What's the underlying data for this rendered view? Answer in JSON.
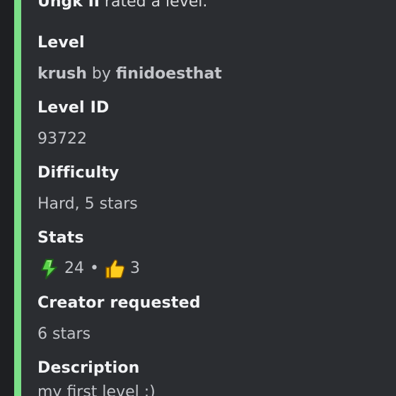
{
  "embed": {
    "accent_color": "#7bdf88",
    "header": {
      "user": "Ungk II",
      "action": " rated a level."
    },
    "level": {
      "label": "Level",
      "name": "krush",
      "by": "by",
      "creator": "finidoesthat"
    },
    "level_id": {
      "label": "Level ID",
      "value": "93722"
    },
    "difficulty": {
      "label": "Difficulty",
      "value": "Hard, 5 stars"
    },
    "stats": {
      "label": "Stats",
      "downloads_icon": "green-download-arrow-icon",
      "downloads": "24",
      "separator": "•",
      "likes_icon": "thumbs-up-icon",
      "likes": "3"
    },
    "creator_requested": {
      "label": "Creator requested",
      "value": "6 stars"
    },
    "description": {
      "label": "Description",
      "value": "my first level :)"
    }
  }
}
